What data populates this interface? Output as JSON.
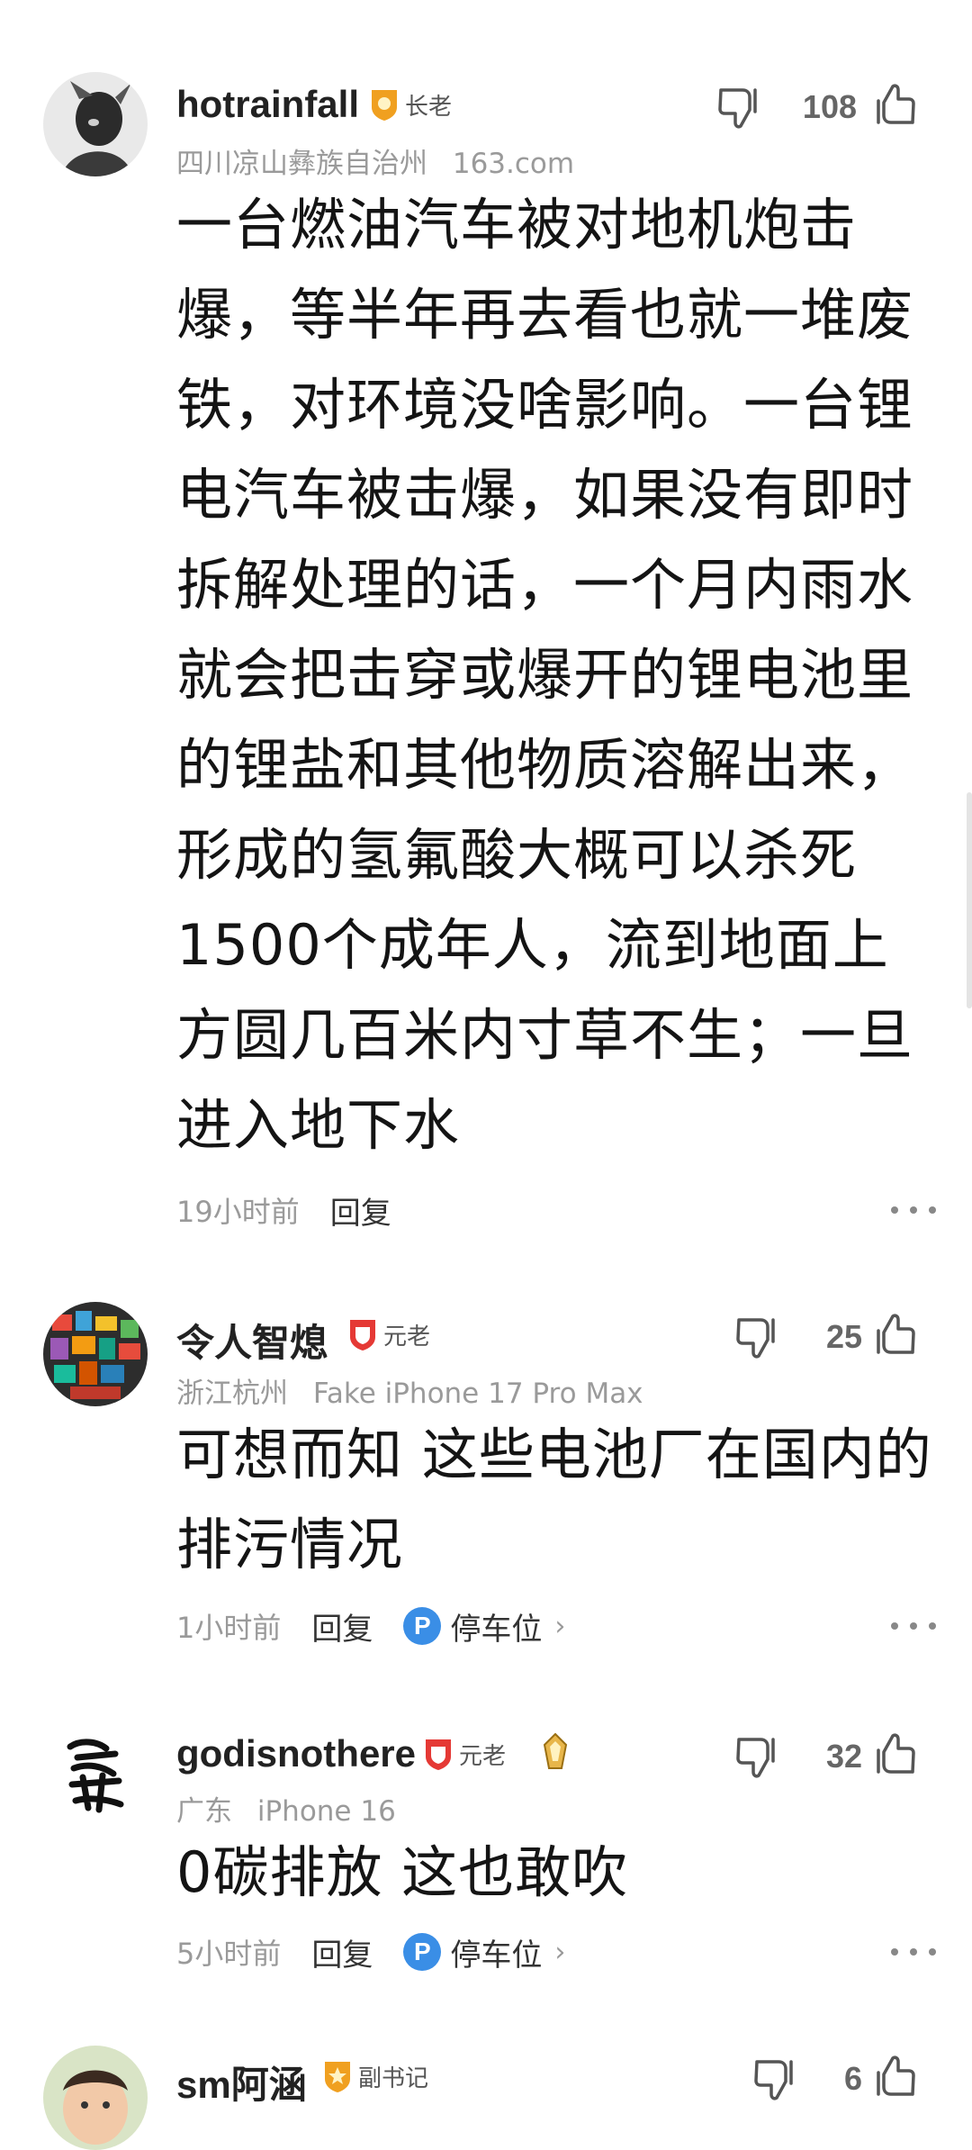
{
  "comments": [
    {
      "username": "hotrainfall",
      "badge": "长老",
      "location": "四川凉山彝族自治州",
      "device": "163.com",
      "likes": "108",
      "text": "一台燃油汽车被对地机炮击爆，等半年再去看也就一堆废铁，对环境没啥影响。一台锂电汽车被击爆，如果没有即时拆解处理的话，一个月内雨水就会把击穿或爆开的锂电池里的锂盐和其他物质溶解出来，形成的氢氟酸大概可以杀死1500个成年人，流到地面上方圆几百米内寸草不生；一旦进入地下水",
      "time": "19小时前",
      "reply": "回复",
      "avatar_icon": "portrait-photo-icon"
    },
    {
      "username": "令人智熄",
      "badge": "元老",
      "location": "浙江杭州",
      "device": "Fake  iPhone 17 Pro Max",
      "likes": "25",
      "text": "可想而知 这些电池厂在国内的排污情况",
      "time": "1小时前",
      "reply": "回复",
      "tag": "停车位",
      "tag_icon": "P",
      "avatar_icon": "colorful-mosaic-icon"
    },
    {
      "username": "godisnothere",
      "badge": "元老",
      "location": "广东",
      "device": "iPhone 16",
      "likes": "32",
      "text": "0碳排放 这也敢吹",
      "time": "5小时前",
      "reply": "回复",
      "tag": "停车位",
      "tag_icon": "P",
      "avatar_icon": "calligraphy-avatar-icon"
    },
    {
      "username": "sm阿涵",
      "badge": "副书记",
      "likes": "6",
      "avatar_icon": "child-photo-icon"
    }
  ],
  "colors": {
    "badge_gold": "#f0a020",
    "badge_red": "#e53935",
    "tag_blue": "#3a8ee6",
    "meta_gray": "#9a9a9a"
  }
}
